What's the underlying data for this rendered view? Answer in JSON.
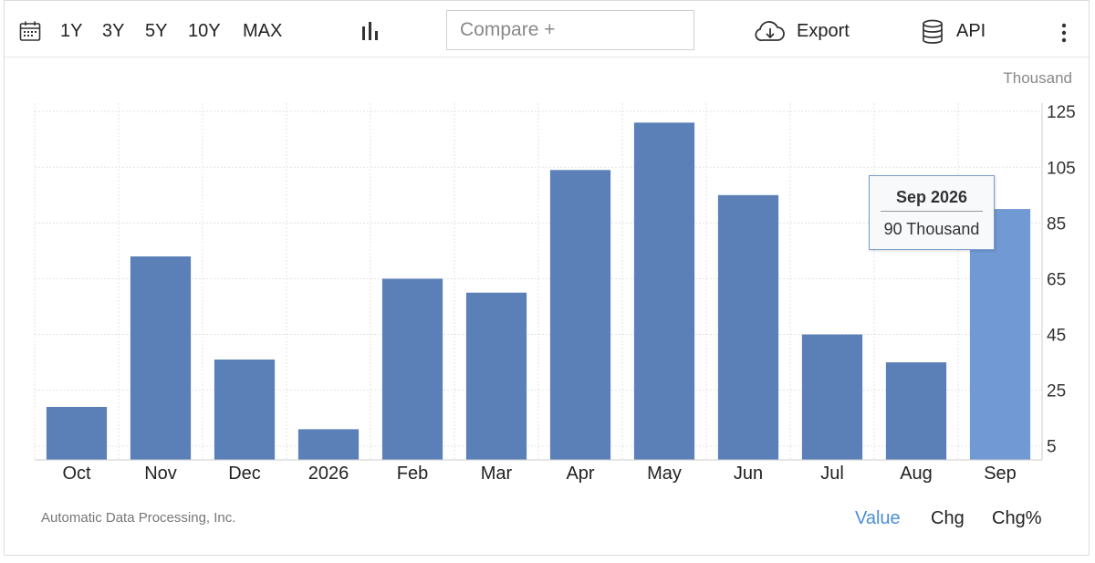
{
  "toolbar": {
    "ranges": [
      "1Y",
      "3Y",
      "5Y",
      "10Y",
      "MAX"
    ],
    "compare_placeholder": "Compare +",
    "export_label": "Export",
    "api_label": "API"
  },
  "source": "Automatic Data Processing, Inc.",
  "view_tabs": [
    "Value",
    "Chg",
    "Chg%"
  ],
  "tooltip": {
    "title": "Sep 2026",
    "value": "90 Thousand"
  },
  "colors": {
    "bar": "#5b80b8",
    "bar_highlight": "#7199d3",
    "active_tab": "#4a8fd4"
  },
  "chart_data": {
    "type": "bar",
    "categories": [
      "Oct",
      "Nov",
      "Dec",
      "2026",
      "Feb",
      "Mar",
      "Apr",
      "May",
      "Jun",
      "Jul",
      "Aug",
      "Sep"
    ],
    "values": [
      19,
      73,
      36,
      11,
      65,
      60,
      104,
      121,
      95,
      45,
      35,
      90
    ],
    "unit_label": "Thousand",
    "yticks": [
      5,
      25,
      45,
      65,
      85,
      105,
      125
    ],
    "ylim": [
      0,
      128
    ],
    "y_axis_position": "right",
    "grid": true,
    "highlighted_index": 11
  }
}
